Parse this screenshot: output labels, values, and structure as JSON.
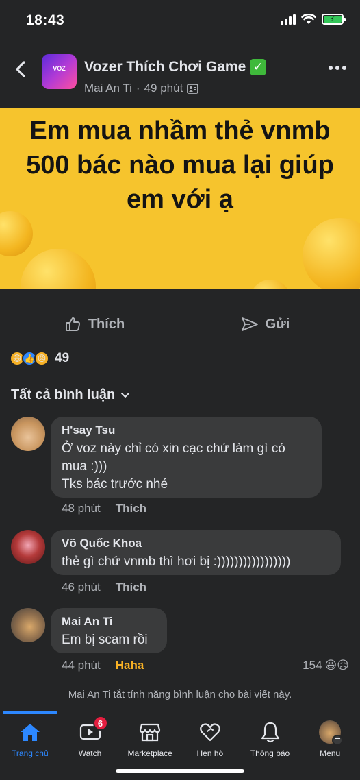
{
  "status_bar": {
    "time": "18:43"
  },
  "header": {
    "group_name": "Vozer Thích Chơi Game",
    "verified_emoji": "✅",
    "author": "Mai An Ti",
    "separator": "·",
    "time_ago": "49 phút",
    "avatar_text": "VOZ",
    "back_icon": "chevron-left-icon",
    "more_icon": "more-horizontal-icon"
  },
  "post": {
    "image_text": "Em mua nhầm thẻ vnmb 500 bác nào mua lại giúp em với ạ",
    "image_bg": "#f6c42d"
  },
  "actions": {
    "like_label": "Thích",
    "send_label": "Gửi"
  },
  "reactions": {
    "count": "49"
  },
  "comments_filter": {
    "label": "Tất cả bình luận"
  },
  "comments": [
    {
      "name": "H'say Tsu",
      "text": "Ở voz này chỉ có xin cạc chứ làm gì có mua :)))\nTks bác trước nhé",
      "time": "48 phút",
      "action": "Thích"
    },
    {
      "name": "Võ Quốc Khoa",
      "text": "thẻ gì chứ vnmb thì hơi bị :)))))))))))))))))",
      "time": "46 phút",
      "action": "Thích"
    },
    {
      "name": "Mai An Ti",
      "text": "Em bị scam rồi",
      "time": "44 phút",
      "action": "Haha",
      "reaction_count": "154"
    }
  ],
  "disabled_note": "Mai An Ti tắt tính năng bình luận cho bài viết này.",
  "bottom_nav": {
    "items": [
      {
        "label": "Trang chủ",
        "icon": "home-icon"
      },
      {
        "label": "Watch",
        "icon": "watch-icon",
        "badge": "6"
      },
      {
        "label": "Marketplace",
        "icon": "marketplace-icon"
      },
      {
        "label": "Hẹn hò",
        "icon": "dating-heart-icon"
      },
      {
        "label": "Thông báo",
        "icon": "bell-icon"
      },
      {
        "label": "Menu",
        "icon": "menu-avatar-icon"
      }
    ]
  },
  "colors": {
    "background": "#242526",
    "bubble": "#3a3b3c",
    "accent": "#2d88ff",
    "haha": "#f7b125"
  }
}
